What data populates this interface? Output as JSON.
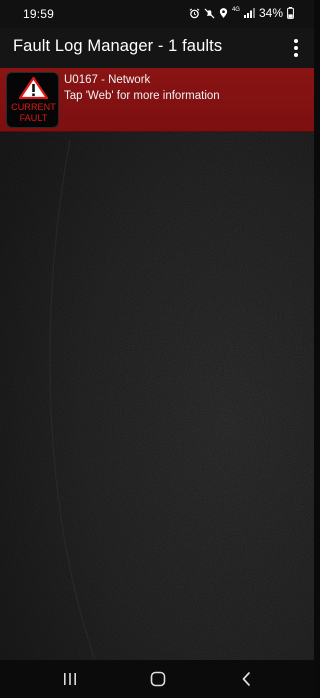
{
  "status_bar": {
    "time": "19:59",
    "network_label": "4G",
    "battery": "34%"
  },
  "app_bar": {
    "title": "Fault Log Manager - 1 faults",
    "menu_icon": "more-vert-icon"
  },
  "fault": {
    "icon_line1": "CURRENT",
    "icon_line2": "FAULT",
    "title": "U0167 - Network",
    "subtitle": "Tap 'Web' for more information",
    "row_color": "#7f1011",
    "icon_text_color": "#e01818"
  },
  "nav_bar": {
    "recent_icon": "recent-apps-icon",
    "home_icon": "home-icon",
    "back_icon": "back-icon"
  }
}
